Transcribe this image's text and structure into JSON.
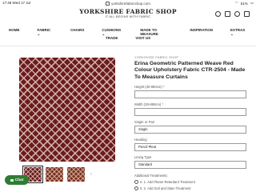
{
  "status": {
    "time": "17:48",
    "date": "Wed 17 Jul",
    "battery": "51%"
  },
  "browser": {
    "url": "yorkshirefabricshop.com"
  },
  "header": {
    "logo": "YORKSHIRE FABRIC SHOP",
    "tagline": "IT ALL BEGINS WITH FABRIC"
  },
  "nav": {
    "row1": [
      "HOME",
      "FABRIC ⌄",
      "CHAIRS",
      "CUSHIONS ⌄",
      "MADE TO MEASURE",
      "INSPIRATION",
      "EXTRAS ⌄"
    ],
    "row2": [
      "TRADE",
      "VISIT US"
    ]
  },
  "product": {
    "vendor": "YORKSHIRE FABRIC SHOP",
    "title": "Erina Geometric Patterned Weave Red Colour Upholstery Fabric CTR-2504 - Made To Measure Curtains",
    "fields": [
      {
        "label": "Height (30-950cm) *",
        "value": ""
      },
      {
        "label": "Width (30-690cm) *",
        "value": ""
      },
      {
        "label": "Single or Pair",
        "value": "Single"
      },
      {
        "label": "Heading",
        "value": "Pencil Pleat"
      },
      {
        "label": "Lining Type",
        "value": "Standard"
      }
    ],
    "additional_label": "Additional Treatments:",
    "options": [
      "0. 1. Add Flame Retardant Treatment",
      "0. 2. Add Soil and Stain Treatment"
    ]
  },
  "chat": {
    "label": "Chat"
  }
}
